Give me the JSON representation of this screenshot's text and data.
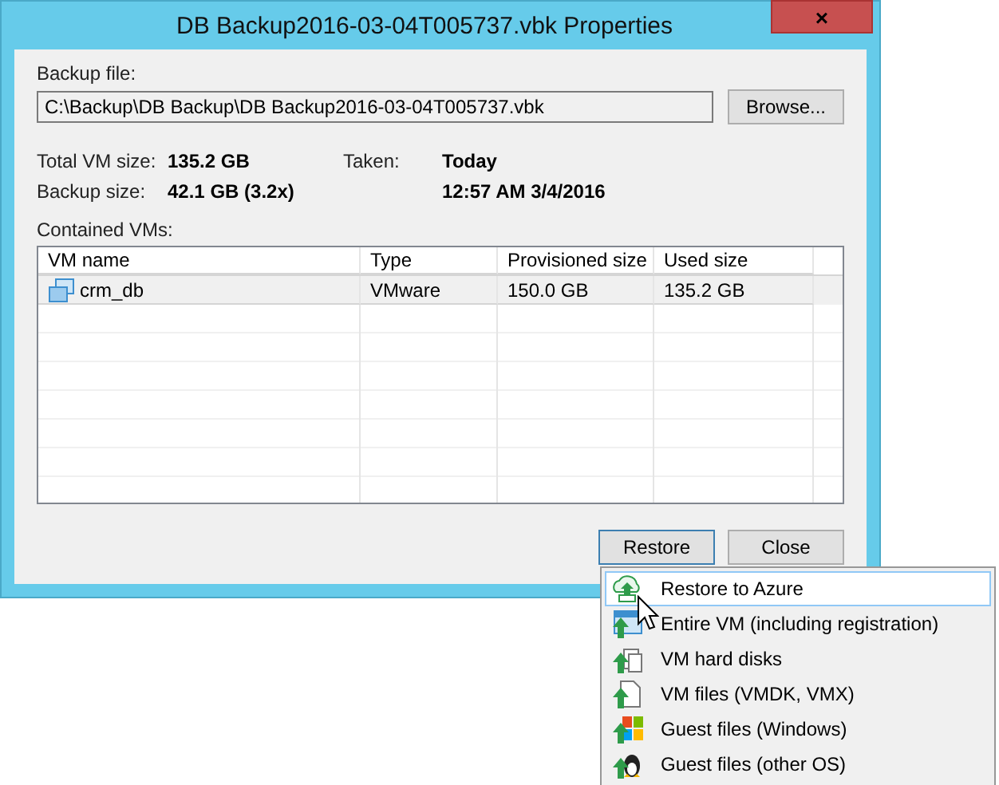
{
  "window": {
    "title": "DB Backup2016-03-04T005737.vbk Properties",
    "close": "×"
  },
  "backup_file": {
    "label": "Backup file:",
    "value": "C:\\Backup\\DB Backup\\DB Backup2016-03-04T005737.vbk",
    "browse": "Browse..."
  },
  "info": [
    {
      "label": "Total VM size:",
      "value": "135.2 GB",
      "label2": "Taken:",
      "value2": "Today"
    },
    {
      "label": "Backup size:",
      "value": "42.1 GB (3.2x)",
      "value2": "12:57 AM 3/4/2016"
    }
  ],
  "contained": {
    "label": "Contained VMs:",
    "columns": [
      "VM name",
      "Type",
      "Provisioned size",
      "Used size"
    ],
    "rows": [
      {
        "cells": [
          "crm_db",
          "VMware",
          "150.0 GB",
          "135.2 GB"
        ],
        "selected": true
      }
    ]
  },
  "buttons": {
    "restore": "Restore",
    "close": "Close"
  },
  "menu": [
    {
      "kind": "azure",
      "label": "Restore to Azure",
      "selected": true
    },
    {
      "kind": "vm",
      "label": "Entire VM (including registration)",
      "selected": false
    },
    {
      "kind": "disks",
      "label": "VM hard disks",
      "selected": false
    },
    {
      "kind": "files",
      "label": "VM files (VMDK, VMX)",
      "selected": false
    },
    {
      "kind": "windows",
      "label": "Guest files (Windows)",
      "selected": false
    },
    {
      "kind": "linux",
      "label": "Guest files (other OS)",
      "selected": false
    }
  ]
}
